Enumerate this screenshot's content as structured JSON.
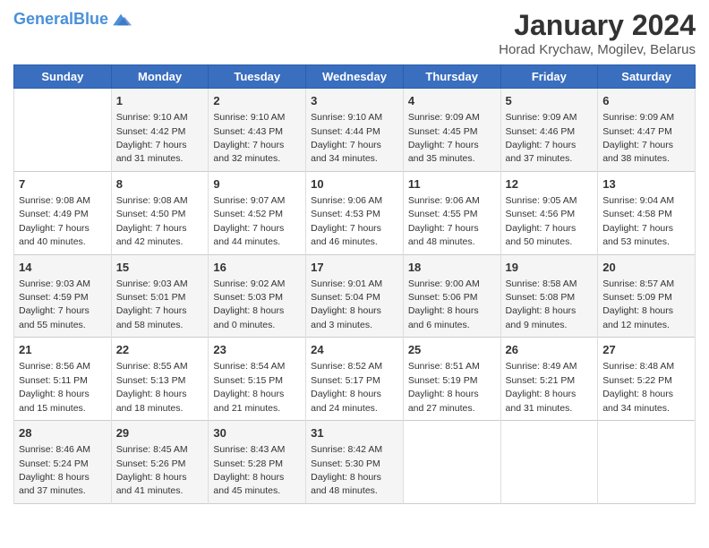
{
  "logo": {
    "line1": "General",
    "line2": "Blue"
  },
  "title": "January 2024",
  "subtitle": "Horad Krychaw, Mogilev, Belarus",
  "days_of_week": [
    "Sunday",
    "Monday",
    "Tuesday",
    "Wednesday",
    "Thursday",
    "Friday",
    "Saturday"
  ],
  "weeks": [
    [
      {
        "day": "",
        "sunrise": "",
        "sunset": "",
        "daylight": ""
      },
      {
        "day": "1",
        "sunrise": "Sunrise: 9:10 AM",
        "sunset": "Sunset: 4:42 PM",
        "daylight": "Daylight: 7 hours and 31 minutes."
      },
      {
        "day": "2",
        "sunrise": "Sunrise: 9:10 AM",
        "sunset": "Sunset: 4:43 PM",
        "daylight": "Daylight: 7 hours and 32 minutes."
      },
      {
        "day": "3",
        "sunrise": "Sunrise: 9:10 AM",
        "sunset": "Sunset: 4:44 PM",
        "daylight": "Daylight: 7 hours and 34 minutes."
      },
      {
        "day": "4",
        "sunrise": "Sunrise: 9:09 AM",
        "sunset": "Sunset: 4:45 PM",
        "daylight": "Daylight: 7 hours and 35 minutes."
      },
      {
        "day": "5",
        "sunrise": "Sunrise: 9:09 AM",
        "sunset": "Sunset: 4:46 PM",
        "daylight": "Daylight: 7 hours and 37 minutes."
      },
      {
        "day": "6",
        "sunrise": "Sunrise: 9:09 AM",
        "sunset": "Sunset: 4:47 PM",
        "daylight": "Daylight: 7 hours and 38 minutes."
      }
    ],
    [
      {
        "day": "7",
        "sunrise": "Sunrise: 9:08 AM",
        "sunset": "Sunset: 4:49 PM",
        "daylight": "Daylight: 7 hours and 40 minutes."
      },
      {
        "day": "8",
        "sunrise": "Sunrise: 9:08 AM",
        "sunset": "Sunset: 4:50 PM",
        "daylight": "Daylight: 7 hours and 42 minutes."
      },
      {
        "day": "9",
        "sunrise": "Sunrise: 9:07 AM",
        "sunset": "Sunset: 4:52 PM",
        "daylight": "Daylight: 7 hours and 44 minutes."
      },
      {
        "day": "10",
        "sunrise": "Sunrise: 9:06 AM",
        "sunset": "Sunset: 4:53 PM",
        "daylight": "Daylight: 7 hours and 46 minutes."
      },
      {
        "day": "11",
        "sunrise": "Sunrise: 9:06 AM",
        "sunset": "Sunset: 4:55 PM",
        "daylight": "Daylight: 7 hours and 48 minutes."
      },
      {
        "day": "12",
        "sunrise": "Sunrise: 9:05 AM",
        "sunset": "Sunset: 4:56 PM",
        "daylight": "Daylight: 7 hours and 50 minutes."
      },
      {
        "day": "13",
        "sunrise": "Sunrise: 9:04 AM",
        "sunset": "Sunset: 4:58 PM",
        "daylight": "Daylight: 7 hours and 53 minutes."
      }
    ],
    [
      {
        "day": "14",
        "sunrise": "Sunrise: 9:03 AM",
        "sunset": "Sunset: 4:59 PM",
        "daylight": "Daylight: 7 hours and 55 minutes."
      },
      {
        "day": "15",
        "sunrise": "Sunrise: 9:03 AM",
        "sunset": "Sunset: 5:01 PM",
        "daylight": "Daylight: 7 hours and 58 minutes."
      },
      {
        "day": "16",
        "sunrise": "Sunrise: 9:02 AM",
        "sunset": "Sunset: 5:03 PM",
        "daylight": "Daylight: 8 hours and 0 minutes."
      },
      {
        "day": "17",
        "sunrise": "Sunrise: 9:01 AM",
        "sunset": "Sunset: 5:04 PM",
        "daylight": "Daylight: 8 hours and 3 minutes."
      },
      {
        "day": "18",
        "sunrise": "Sunrise: 9:00 AM",
        "sunset": "Sunset: 5:06 PM",
        "daylight": "Daylight: 8 hours and 6 minutes."
      },
      {
        "day": "19",
        "sunrise": "Sunrise: 8:58 AM",
        "sunset": "Sunset: 5:08 PM",
        "daylight": "Daylight: 8 hours and 9 minutes."
      },
      {
        "day": "20",
        "sunrise": "Sunrise: 8:57 AM",
        "sunset": "Sunset: 5:09 PM",
        "daylight": "Daylight: 8 hours and 12 minutes."
      }
    ],
    [
      {
        "day": "21",
        "sunrise": "Sunrise: 8:56 AM",
        "sunset": "Sunset: 5:11 PM",
        "daylight": "Daylight: 8 hours and 15 minutes."
      },
      {
        "day": "22",
        "sunrise": "Sunrise: 8:55 AM",
        "sunset": "Sunset: 5:13 PM",
        "daylight": "Daylight: 8 hours and 18 minutes."
      },
      {
        "day": "23",
        "sunrise": "Sunrise: 8:54 AM",
        "sunset": "Sunset: 5:15 PM",
        "daylight": "Daylight: 8 hours and 21 minutes."
      },
      {
        "day": "24",
        "sunrise": "Sunrise: 8:52 AM",
        "sunset": "Sunset: 5:17 PM",
        "daylight": "Daylight: 8 hours and 24 minutes."
      },
      {
        "day": "25",
        "sunrise": "Sunrise: 8:51 AM",
        "sunset": "Sunset: 5:19 PM",
        "daylight": "Daylight: 8 hours and 27 minutes."
      },
      {
        "day": "26",
        "sunrise": "Sunrise: 8:49 AM",
        "sunset": "Sunset: 5:21 PM",
        "daylight": "Daylight: 8 hours and 31 minutes."
      },
      {
        "day": "27",
        "sunrise": "Sunrise: 8:48 AM",
        "sunset": "Sunset: 5:22 PM",
        "daylight": "Daylight: 8 hours and 34 minutes."
      }
    ],
    [
      {
        "day": "28",
        "sunrise": "Sunrise: 8:46 AM",
        "sunset": "Sunset: 5:24 PM",
        "daylight": "Daylight: 8 hours and 37 minutes."
      },
      {
        "day": "29",
        "sunrise": "Sunrise: 8:45 AM",
        "sunset": "Sunset: 5:26 PM",
        "daylight": "Daylight: 8 hours and 41 minutes."
      },
      {
        "day": "30",
        "sunrise": "Sunrise: 8:43 AM",
        "sunset": "Sunset: 5:28 PM",
        "daylight": "Daylight: 8 hours and 45 minutes."
      },
      {
        "day": "31",
        "sunrise": "Sunrise: 8:42 AM",
        "sunset": "Sunset: 5:30 PM",
        "daylight": "Daylight: 8 hours and 48 minutes."
      },
      {
        "day": "",
        "sunrise": "",
        "sunset": "",
        "daylight": ""
      },
      {
        "day": "",
        "sunrise": "",
        "sunset": "",
        "daylight": ""
      },
      {
        "day": "",
        "sunrise": "",
        "sunset": "",
        "daylight": ""
      }
    ]
  ]
}
